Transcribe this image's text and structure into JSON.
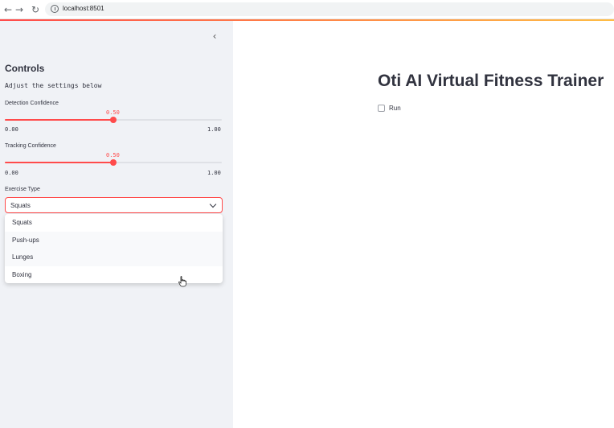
{
  "browser": {
    "url": "localhost:8501",
    "back_icon": "arrow-left",
    "forward_icon": "arrow-right",
    "reload_icon": "reload"
  },
  "sidebar": {
    "collapse_icon": "chevron-left",
    "title": "Controls",
    "subtitle": "Adjust the settings below",
    "sliders": [
      {
        "label": "Detection Confidence",
        "value": "0.50",
        "min": "0.00",
        "max": "1.00",
        "fraction": 0.5
      },
      {
        "label": "Tracking Confidence",
        "value": "0.50",
        "min": "0.00",
        "max": "1.00",
        "fraction": 0.5
      }
    ],
    "exercise_select": {
      "label": "Exercise Type",
      "selected": "Squats",
      "options": [
        "Squats",
        "Push-ups",
        "Lunges",
        "Boxing"
      ]
    }
  },
  "main": {
    "title": "Oti AI Virtual Fitness Trainer",
    "run_checkbox": {
      "label": "Run",
      "checked": false
    }
  },
  "colors": {
    "accent": "#ff4b4b",
    "sidebar_bg": "#f0f2f6",
    "text": "#31333f"
  }
}
